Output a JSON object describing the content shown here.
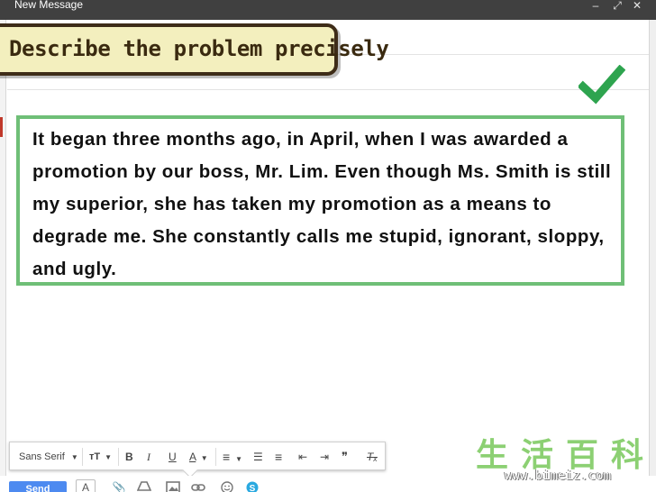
{
  "window": {
    "title": "New Message",
    "minimize_glyph": "–",
    "popout_glyph": "⤢",
    "close_glyph": "✕"
  },
  "banner": {
    "text": "Describe the problem precisely"
  },
  "check_icon": "checkmark-icon",
  "message": {
    "body": "It began three months ago, in April, when I was awarded a promotion by our boss, Mr. Lim. Even though Ms. Smith is still my superior, she has taken my promotion as a means to degrade me. She constantly calls me stupid, ignorant, sloppy, and ugly."
  },
  "toolbar": {
    "font_family": "Sans Serif",
    "font_size_glyph": "тT",
    "bold_glyph": "B",
    "italic_glyph": "I",
    "underline_glyph": "U",
    "text_color_glyph": "A",
    "align_glyph": "≡",
    "numbered_list_glyph": "☰",
    "bulleted_list_glyph": "≡",
    "indent_less_glyph": "⇤",
    "indent_more_glyph": "⇥",
    "quote_glyph": "❞",
    "clear_formatting_glyph": "Tₓ"
  },
  "compose_bar": {
    "send_label": "Send",
    "formatting_toggle_glyph": "A",
    "icons": [
      "attach-icon",
      "drive-icon",
      "photo-icon",
      "link-icon",
      "emoji-icon",
      "skype-icon"
    ]
  },
  "watermark": {
    "chinese": "生活百科",
    "url": "www.bimeiz.com"
  },
  "colors": {
    "titlebar": "#404040",
    "banner_bg": "#f3efbe",
    "banner_border": "#3e2c18",
    "box_border": "#6fbf77",
    "check": "#2ea44f",
    "send": "#4d8af0"
  }
}
